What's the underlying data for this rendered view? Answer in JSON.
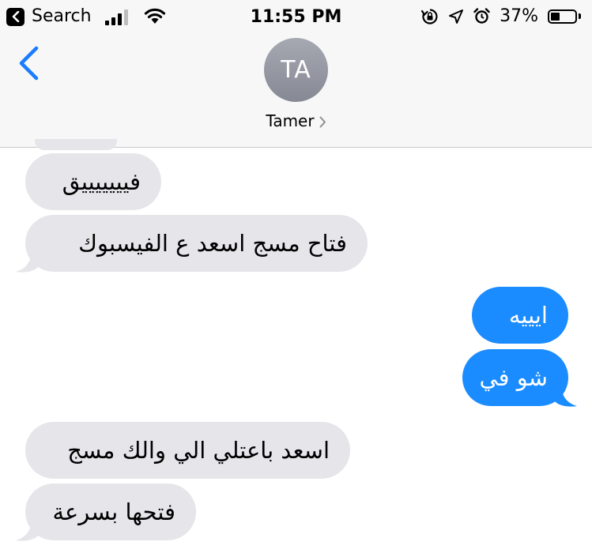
{
  "status_bar": {
    "back_app_label": "Search",
    "time": "11:55 PM",
    "battery_percent": "37%",
    "battery_level": 0.37
  },
  "header": {
    "avatar_initials": "TA",
    "contact_name": "Tamer"
  },
  "messages": [
    {
      "direction": "received",
      "text": "فيييييييق"
    },
    {
      "direction": "received",
      "text": "فتاح مسج اسعد ع الفيسبوك"
    },
    {
      "direction": "sent",
      "text": "ايييه"
    },
    {
      "direction": "sent",
      "text": "شو في"
    },
    {
      "direction": "received",
      "text": "اسعد باعتلي الي والك مسج"
    },
    {
      "direction": "received",
      "text": "فتحها بسرعة"
    }
  ],
  "colors": {
    "sent_bubble": "#1a8cff",
    "received_bubble": "#e5e5ea",
    "accent": "#1a7cff"
  }
}
